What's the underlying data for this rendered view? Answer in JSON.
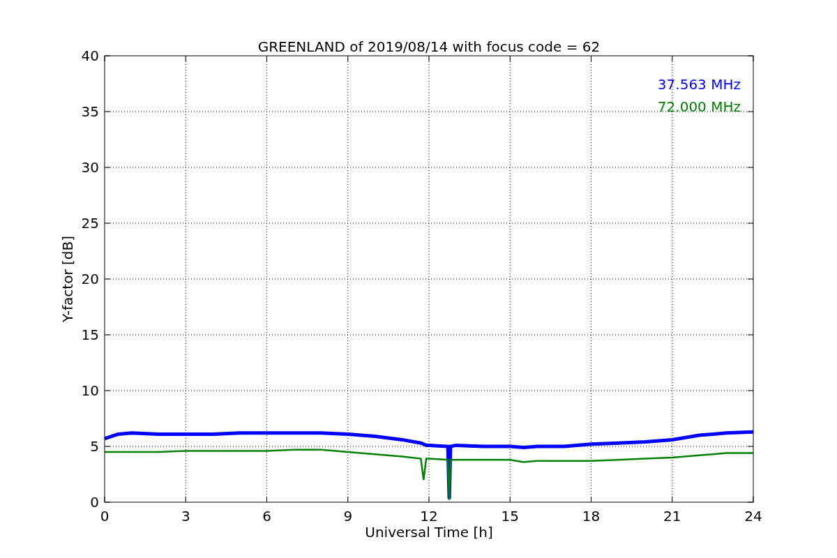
{
  "figure": {
    "chart_data": {
      "type": "line",
      "title": "GREENLAND of 2019/08/14 with focus code = 62",
      "xlabel": "Universal Time [h]",
      "ylabel": "Y-factor [dB]",
      "x": [
        0,
        0.5,
        1,
        2,
        3,
        4,
        5,
        6,
        7,
        8,
        9,
        10,
        11,
        11.7,
        11.8,
        11.9,
        12,
        12.7,
        12.75,
        12.8,
        13,
        14,
        15,
        15.5,
        16,
        17,
        18,
        19,
        20,
        21,
        22,
        23,
        24
      ],
      "series": [
        {
          "name": "37.563 MHz",
          "color": "#0000ff",
          "values": [
            5.7,
            6.1,
            6.2,
            6.1,
            6.1,
            6.1,
            6.2,
            6.2,
            6.2,
            6.2,
            6.1,
            5.9,
            5.6,
            5.3,
            5.2,
            5.1,
            5.1,
            5.0,
            0.3,
            5.0,
            5.1,
            5.0,
            5.0,
            4.9,
            5.0,
            5.0,
            5.2,
            5.3,
            5.4,
            5.6,
            6.0,
            6.2,
            6.3
          ]
        },
        {
          "name": "72.000 MHz",
          "color": "#008000",
          "values": [
            4.5,
            4.5,
            4.5,
            4.5,
            4.6,
            4.6,
            4.6,
            4.6,
            4.7,
            4.7,
            4.5,
            4.3,
            4.1,
            3.9,
            2.0,
            3.9,
            3.9,
            3.8,
            0.2,
            3.8,
            3.8,
            3.8,
            3.8,
            3.6,
            3.7,
            3.7,
            3.7,
            3.8,
            3.9,
            4.0,
            4.2,
            4.4,
            4.4
          ]
        }
      ],
      "xlim": [
        0,
        24
      ],
      "ylim": [
        0,
        40
      ],
      "xticks": [
        0,
        3,
        6,
        9,
        12,
        15,
        18,
        21,
        24
      ],
      "yticks": [
        0,
        5,
        10,
        15,
        20,
        25,
        30,
        35,
        40
      ],
      "grid": true
    }
  }
}
